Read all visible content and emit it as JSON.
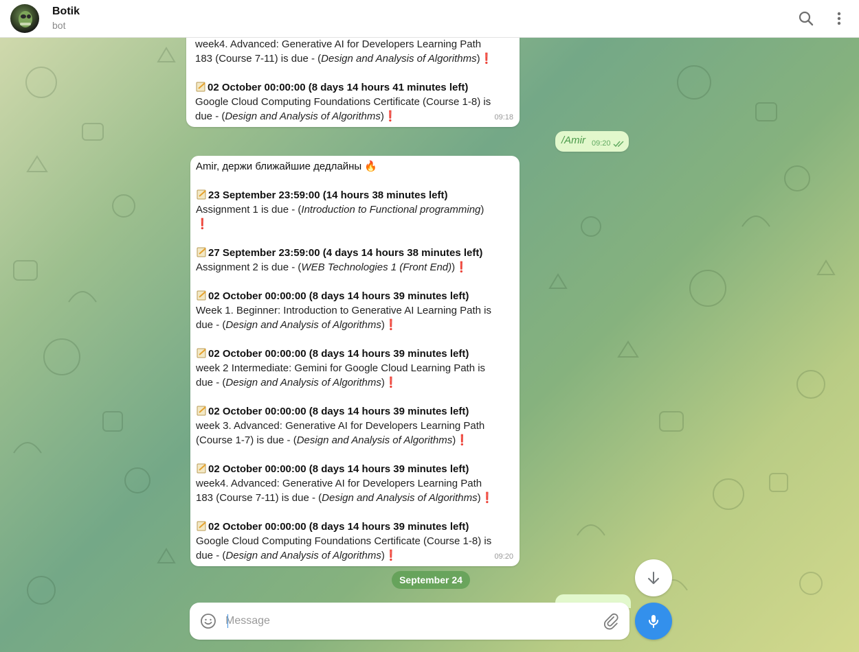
{
  "header": {
    "title": "Botik",
    "subtitle": "bot"
  },
  "messages": {
    "top": {
      "lines": [
        {
          "plain": "week4. Advanced: Generative AI for Developers Learning Path"
        },
        {
          "plain": "183 (Course 7-11) is due - (",
          "italic": "Design and Analysis of Algorithms",
          "tail": ")"
        },
        {
          "bold": "02 October 00:00:00 (8 days 14 hours 41 minutes left)"
        },
        {
          "plain": "Google Cloud Computing Foundations Certificate  (Course 1-8)  is"
        },
        {
          "plain": "due - (",
          "italic": "Design and Analysis of Algorithms",
          "tail": ")"
        }
      ],
      "time": "09:18"
    },
    "outgoing": {
      "text": "/Amir",
      "time": "09:20"
    },
    "main": {
      "title": "Amir, держи ближайшие дедлайны",
      "items": [
        {
          "header": "23 September 23:59:00 (14 hours 38 minutes left)",
          "line1": "Assignment 1 is due - (",
          "course": "Introduction to Functional programming",
          "line1_tail": ")",
          "line2": ""
        },
        {
          "header": "27 September 23:59:00 (4 days 14 hours 38 minutes left)",
          "line1": "Assignment 2 is due - (",
          "course": "WEB Technologies 1 (Front End)",
          "line1_tail": ")",
          "line2": ""
        },
        {
          "header": "02 October 00:00:00 (8 days 14 hours 39 minutes left)",
          "line1": "Week 1. Beginner: Introduction to Generative AI Learning Path  is",
          "line2_prefix": "due - (",
          "course": "Design and Analysis of Algorithms",
          "line2_tail": ")"
        },
        {
          "header": "02 October 00:00:00 (8 days 14 hours 39 minutes left)",
          "line1": "week 2 Intermediate: Gemini for Google Cloud Learning Path  is",
          "line2_prefix": "due - (",
          "course": "Design and Analysis of Algorithms",
          "line2_tail": ")"
        },
        {
          "header": "02 October 00:00:00 (8 days 14 hours 39 minutes left)",
          "line1": "week 3. Advanced: Generative AI for Developers Learning Path",
          "line2_prefix": "(Course 1-7) is due - (",
          "course": "Design and Analysis of Algorithms",
          "line2_tail": ")"
        },
        {
          "header": "02 October 00:00:00 (8 days 14 hours 39 minutes left)",
          "line1": "week4. Advanced: Generative AI for Developers Learning Path",
          "line2_prefix": "183 (Course 7-11) is due - (",
          "course": "Design and Analysis of Algorithms",
          "line2_tail": ")"
        },
        {
          "header": "02 October 00:00:00 (8 days 14 hours 39 minutes left)",
          "line1": "Google Cloud Computing Foundations Certificate  (Course 1-8)  is",
          "line2_prefix": "due - (",
          "course": "Design and Analysis of Algorithms",
          "line2_tail": ")"
        }
      ],
      "time": "09:20"
    }
  },
  "date_chip": "September 24",
  "composer": {
    "placeholder": "Message"
  },
  "icons": {
    "search": "search-icon",
    "menu": "more-vertical-icon",
    "emoji": "smiley-icon",
    "attach": "paperclip-icon",
    "mic": "microphone-icon",
    "scroll": "arrow-down-icon",
    "memo": "memo-icon",
    "fire": "fire-icon",
    "exclamation": "red-exclamation-icon"
  },
  "colors": {
    "accent": "#3390ec",
    "outgoing_bubble": "#e2f8cc",
    "exclamation": "#e0212b"
  }
}
